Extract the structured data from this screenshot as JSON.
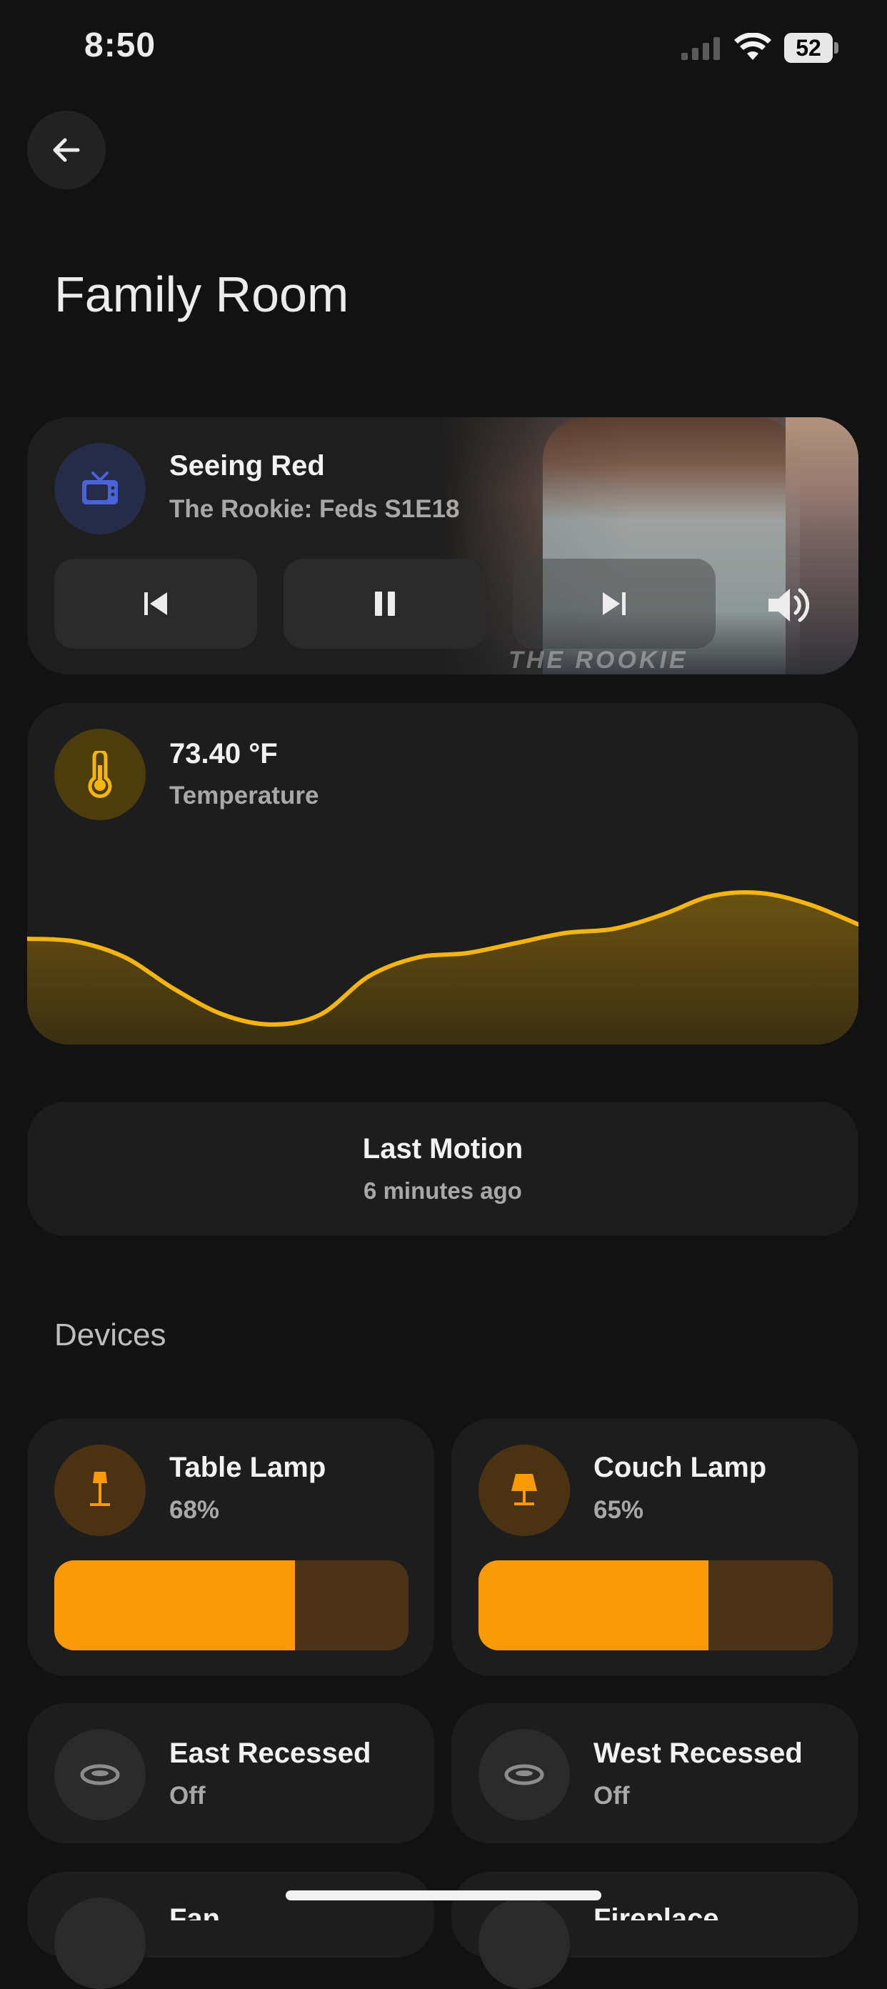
{
  "status": {
    "time": "8:50",
    "battery": "52"
  },
  "page": {
    "title": "Family Room"
  },
  "media": {
    "title": "Seeing Red",
    "subtitle": "The Rookie: Feds S1E18",
    "art_text": "THE ROOKIE"
  },
  "temperature": {
    "value": "73.40 °F",
    "label": "Temperature",
    "colors": {
      "line": "#f5b50f",
      "fill": "#5a4613"
    },
    "chart_data": {
      "type": "area",
      "values": [
        0.68,
        0.66,
        0.55,
        0.33,
        0.15,
        0.08,
        0.15,
        0.42,
        0.55,
        0.58,
        0.65,
        0.72,
        0.75,
        0.85,
        0.98,
        1.0,
        0.92,
        0.78
      ]
    }
  },
  "motion": {
    "title": "Last Motion",
    "subtitle": "6 minutes ago"
  },
  "devices_section": {
    "title": "Devices"
  },
  "devices": [
    {
      "name": "Table Lamp",
      "state": "68%",
      "level": 0.68
    },
    {
      "name": "Couch Lamp",
      "state": "65%",
      "level": 0.65
    },
    {
      "name": "East Recessed",
      "state": "Off"
    },
    {
      "name": "West Recessed",
      "state": "Off"
    },
    {
      "name": "Fan",
      "state": ""
    },
    {
      "name": "Fireplace",
      "state": ""
    }
  ],
  "colors": {
    "accent": "#fa9a07",
    "slider_track": "#4a3216",
    "tv_icon": "#4a63d6",
    "thermo_icon": "#f5b50f"
  }
}
